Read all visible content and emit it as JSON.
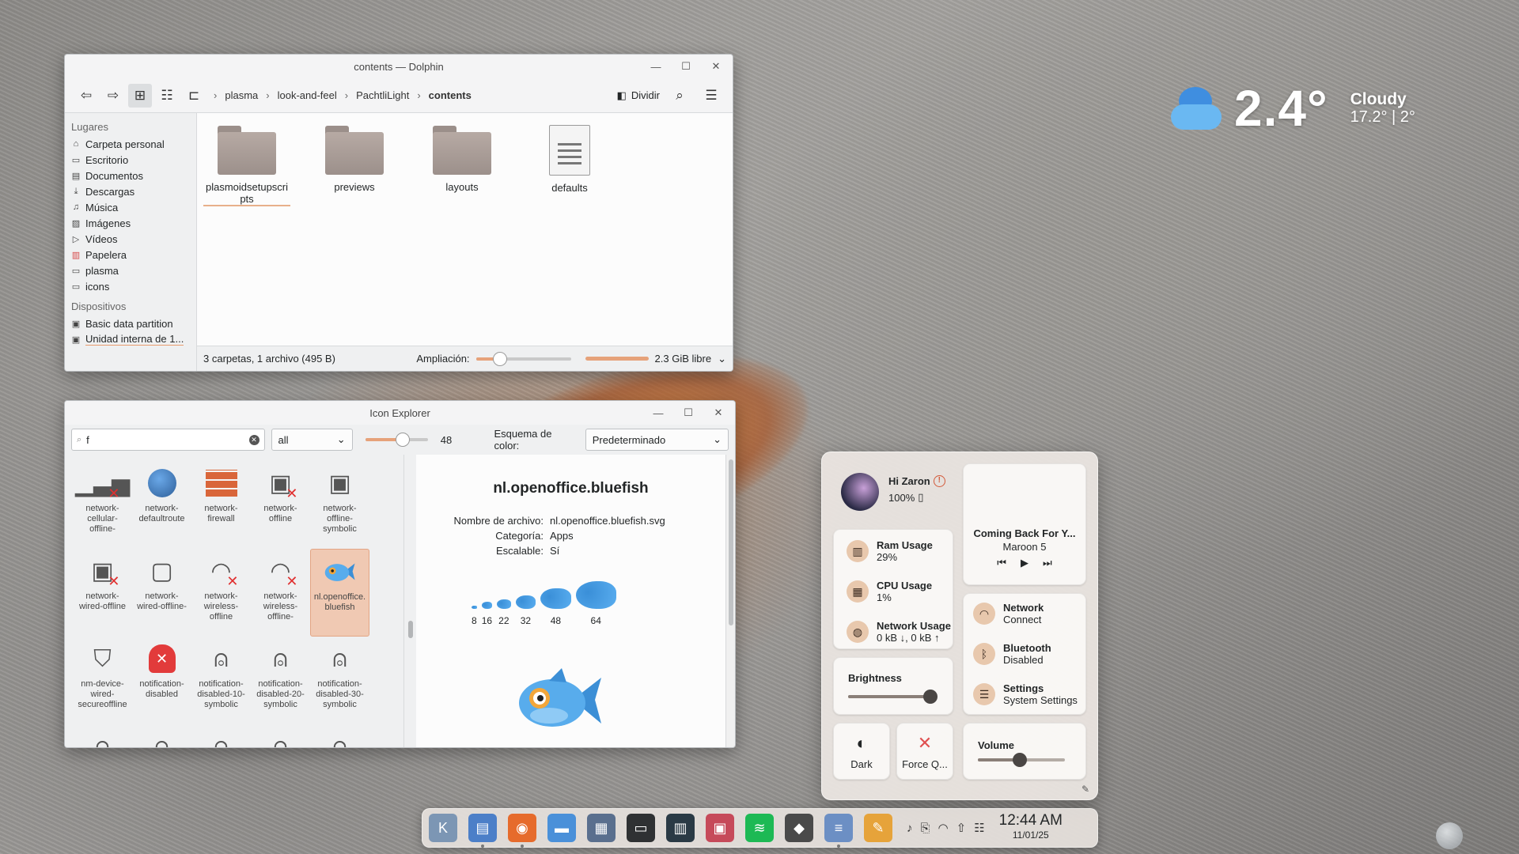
{
  "dolphin": {
    "title": "contents — Dolphin",
    "breadcrumb": [
      "plasma",
      "look-and-feel",
      "PachtliLight",
      "contents"
    ],
    "split_label": "Dividir",
    "places_title": "Lugares",
    "places": [
      {
        "label": "Carpeta personal",
        "icon": "home-icon"
      },
      {
        "label": "Escritorio",
        "icon": "desktop-icon"
      },
      {
        "label": "Documentos",
        "icon": "document-icon"
      },
      {
        "label": "Descargas",
        "icon": "download-icon"
      },
      {
        "label": "Música",
        "icon": "music-icon"
      },
      {
        "label": "Imágenes",
        "icon": "image-icon"
      },
      {
        "label": "Vídeos",
        "icon": "video-icon"
      },
      {
        "label": "Papelera",
        "icon": "trash-icon"
      },
      {
        "label": "plasma",
        "icon": "folder-icon"
      },
      {
        "label": "icons",
        "icon": "folder-icon"
      }
    ],
    "devices_title": "Dispositivos",
    "devices": [
      {
        "label": "Basic data partition",
        "icon": "drive-icon"
      },
      {
        "label": "Unidad interna de 1...",
        "icon": "drive-icon"
      }
    ],
    "files": [
      {
        "name": "plasmoidsetupscripts",
        "type": "folder"
      },
      {
        "name": "previews",
        "type": "folder"
      },
      {
        "name": "layouts",
        "type": "folder"
      },
      {
        "name": "defaults",
        "type": "file"
      }
    ],
    "status_text": "3 carpetas, 1 archivo (495 B)",
    "zoom_label": "Ampliación:",
    "zoom_level": 0.25,
    "free_space": "2.3 GiB libre"
  },
  "icon_explorer": {
    "title": "Icon Explorer",
    "search_value": "f",
    "filter_value": "all",
    "size_value": "48",
    "size_level": 0.6,
    "color_scheme_label": "Esquema de color:",
    "color_scheme_value": "Predeterminado",
    "icons": [
      {
        "name": "network-cellular-offline-",
        "icon": "signal-bars-icon",
        "x": true
      },
      {
        "name": "network-defaultroute",
        "icon": "globe-icon",
        "x": false
      },
      {
        "name": "network-firewall",
        "icon": "firewall-icon",
        "x": false
      },
      {
        "name": "network-offline",
        "icon": "monitor-network-icon",
        "x": true
      },
      {
        "name": "network-offline-symbolic",
        "icon": "monitor-network-icon",
        "x": false
      },
      {
        "name": "network-wired-offline",
        "icon": "monitor-network-icon",
        "x": true
      },
      {
        "name": "network-wired-offline-",
        "icon": "computer-icon",
        "x": false
      },
      {
        "name": "network-wireless-offline",
        "icon": "wifi-icon",
        "x": true
      },
      {
        "name": "network-wireless-offline-",
        "icon": "wifi-icon",
        "x": true
      },
      {
        "name": "nl.openoffice.bluefish",
        "icon": "fish-icon",
        "x": false,
        "selected": true
      },
      {
        "name": "nm-device-wired-secureoffline",
        "icon": "shield-icon",
        "x": false
      },
      {
        "name": "notification-disabled",
        "icon": "bell-icon",
        "x": false,
        "red": true
      },
      {
        "name": "notification-disabled-10-symbolic",
        "icon": "bell-icon",
        "x": false
      },
      {
        "name": "notification-disabled-20-symbolic",
        "icon": "bell-icon",
        "x": false
      },
      {
        "name": "notification-disabled-30-symbolic",
        "icon": "bell-icon",
        "x": false
      },
      {
        "name": "",
        "icon": "bell-icon",
        "x": false
      },
      {
        "name": "",
        "icon": "bell-icon",
        "x": false
      },
      {
        "name": "",
        "icon": "bell-icon",
        "x": false
      },
      {
        "name": "",
        "icon": "bell-icon",
        "x": false
      },
      {
        "name": "",
        "icon": "bell-icon",
        "x": false
      }
    ],
    "detail": {
      "title": "nl.openoffice.bluefish",
      "filename_label": "Nombre de archivo:",
      "filename_value": "nl.openoffice.bluefish.svg",
      "category_label": "Categoría:",
      "category_value": "Apps",
      "scalable_label": "Escalable:",
      "scalable_value": "Sí",
      "sizes": [
        "8",
        "16",
        "22",
        "32",
        "48",
        "64"
      ]
    }
  },
  "weather": {
    "temperature": "2.4°",
    "condition": "Cloudy",
    "range": "17.2° | 2°"
  },
  "control_center": {
    "user_greeting": "Hi Zaron",
    "battery": "100%",
    "stats": [
      {
        "title": "Ram Usage",
        "value": "29%",
        "icon": "ram-icon"
      },
      {
        "title": "CPU Usage",
        "value": "1%",
        "icon": "cpu-icon"
      },
      {
        "title": "Network Usage",
        "value": "0 kB ↓, 0 kB ↑",
        "icon": "globe-icon"
      }
    ],
    "media": {
      "title": "Coming Back For Y...",
      "artist": "Maroon 5"
    },
    "toggles": [
      {
        "title": "Network",
        "subtitle": "Connect",
        "icon": "wifi-icon"
      },
      {
        "title": "Bluetooth",
        "subtitle": "Disabled",
        "icon": "bluetooth-icon"
      },
      {
        "title": "Settings",
        "subtitle": "System Settings",
        "icon": "settings-icon"
      }
    ],
    "brightness_label": "Brightness",
    "brightness_level": 1.0,
    "dark_label": "Dark",
    "force_quit_label": "Force Q...",
    "volume_label": "Volume",
    "volume_level": 0.48
  },
  "taskbar": {
    "apps": [
      {
        "name": "kde-launcher-icon",
        "color": "#7c96b4",
        "glyph": "K"
      },
      {
        "name": "dolphin-icon",
        "color": "#4c7fc8",
        "glyph": "▤",
        "running": true
      },
      {
        "name": "firefox-icon",
        "color": "#e66b2c",
        "glyph": "◉",
        "running": true
      },
      {
        "name": "files-icon",
        "color": "#4a90d9",
        "glyph": "▬"
      },
      {
        "name": "image-viewer-icon",
        "color": "#5a6f8e",
        "glyph": "▦"
      },
      {
        "name": "terminal-icon",
        "color": "#2f3133",
        "glyph": "▭"
      },
      {
        "name": "system-monitor-icon",
        "color": "#2a3a45",
        "glyph": "▥"
      },
      {
        "name": "spreadsheet-icon",
        "color": "#c64a5a",
        "glyph": "▣"
      },
      {
        "name": "spotify-icon",
        "color": "#1db954",
        "glyph": "≋"
      },
      {
        "name": "inkscape-icon",
        "color": "#4a4a4a",
        "glyph": "◆"
      },
      {
        "name": "notes-icon",
        "color": "#6c8fc4",
        "glyph": "≡",
        "running": true
      },
      {
        "name": "color-picker-icon",
        "color": "#e6a33a",
        "glyph": "✎"
      }
    ],
    "tray": [
      "notification-bell-icon",
      "clipboard-icon",
      "wifi-icon",
      "updates-icon",
      "settings-sliders-icon"
    ],
    "time": "12:44 AM",
    "date": "11/01/25"
  },
  "colors": {
    "accent": "#e6a27a",
    "selection": "#f0c9b3",
    "danger": "#e03030"
  }
}
